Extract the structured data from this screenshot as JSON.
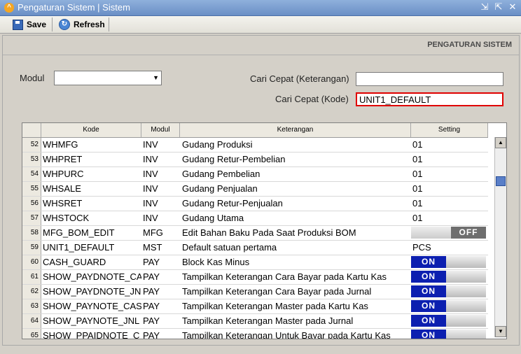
{
  "window": {
    "title": "Pengaturan Sistem | Sistem"
  },
  "toolbar": {
    "save_label": "Save",
    "refresh_label": "Refresh"
  },
  "panel": {
    "header": "PENGATURAN SISTEM"
  },
  "form": {
    "modul_label": "Modul",
    "modul_value": "",
    "cari_ket_label": "Cari Cepat (Keterangan)",
    "cari_ket_value": "",
    "cari_kode_label": "Cari Cepat (Kode)",
    "cari_kode_value": "UNIT1_DEFAULT"
  },
  "grid": {
    "columns": {
      "kode": "Kode",
      "modul": "Modul",
      "keterangan": "Keterangan",
      "setting": "Setting"
    },
    "rows": [
      {
        "num": "52",
        "kode": "WHMFG",
        "modul": "INV",
        "keterangan": "Gudang Produksi",
        "setting": "01",
        "type": "text"
      },
      {
        "num": "53",
        "kode": "WHPRET",
        "modul": "INV",
        "keterangan": "Gudang Retur-Pembelian",
        "setting": "01",
        "type": "text"
      },
      {
        "num": "54",
        "kode": "WHPURC",
        "modul": "INV",
        "keterangan": "Gudang Pembelian",
        "setting": "01",
        "type": "text"
      },
      {
        "num": "55",
        "kode": "WHSALE",
        "modul": "INV",
        "keterangan": "Gudang Penjualan",
        "setting": "01",
        "type": "text"
      },
      {
        "num": "56",
        "kode": "WHSRET",
        "modul": "INV",
        "keterangan": "Gudang Retur-Penjualan",
        "setting": "01",
        "type": "text"
      },
      {
        "num": "57",
        "kode": "WHSTOCK",
        "modul": "INV",
        "keterangan": "Gudang Utama",
        "setting": "01",
        "type": "text"
      },
      {
        "num": "58",
        "kode": "MFG_BOM_EDIT",
        "modul": "MFG",
        "keterangan": "Edit Bahan Baku Pada Saat Produksi BOM",
        "setting": "OFF",
        "type": "off"
      },
      {
        "num": "59",
        "kode": "UNIT1_DEFAULT",
        "modul": "MST",
        "keterangan": "Default satuan pertama",
        "setting": "PCS",
        "type": "text"
      },
      {
        "num": "60",
        "kode": "CASH_GUARD",
        "modul": "PAY",
        "keterangan": "Block Kas Minus",
        "setting": "ON",
        "type": "on"
      },
      {
        "num": "61",
        "kode": "SHOW_PAYDNOTE_CA",
        "modul": "PAY",
        "keterangan": "Tampilkan Keterangan Cara Bayar pada Kartu Kas",
        "setting": "ON",
        "type": "on"
      },
      {
        "num": "62",
        "kode": "SHOW_PAYDNOTE_JN",
        "modul": "PAY",
        "keterangan": "Tampilkan Keterangan Cara Bayar pada Jurnal",
        "setting": "ON",
        "type": "on"
      },
      {
        "num": "63",
        "kode": "SHOW_PAYNOTE_CAS",
        "modul": "PAY",
        "keterangan": "Tampilkan Keterangan Master pada Kartu Kas",
        "setting": "ON",
        "type": "on"
      },
      {
        "num": "64",
        "kode": "SHOW_PAYNOTE_JNL",
        "modul": "PAY",
        "keterangan": "Tampilkan Keterangan Master pada Jurnal",
        "setting": "ON",
        "type": "on"
      },
      {
        "num": "65",
        "kode": "SHOW_PPAIDNOTE_C",
        "modul": "PAY",
        "keterangan": "Tampilkan Keterangan Untuk Bayar pada Kartu Kas",
        "setting": "ON",
        "type": "on"
      }
    ]
  }
}
